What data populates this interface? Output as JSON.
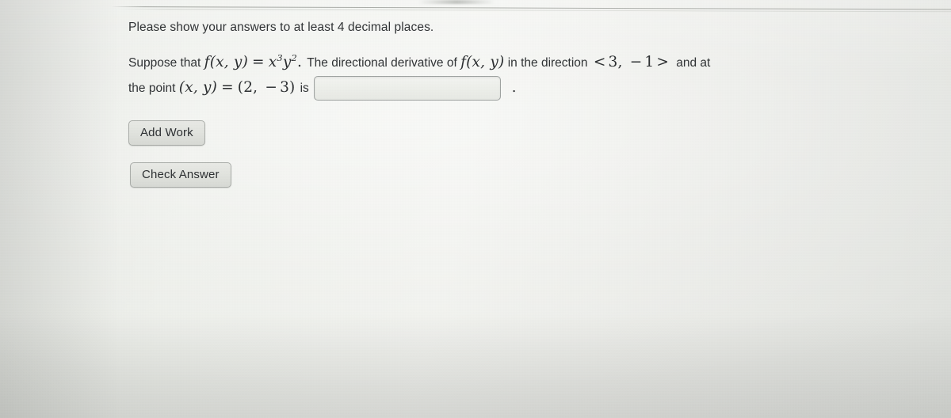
{
  "page": {
    "instruction": "Please show your answers to at least 4 decimal places."
  },
  "problem": {
    "line1": {
      "prefix": "Suppose that",
      "function_name_open": "f(x, y)",
      "equals": "=",
      "function_expression_base_x": "x",
      "function_expression_exp_x": "3",
      "function_expression_base_y": "y",
      "function_expression_exp_y": "2",
      "expression_period": ".",
      "middle_text": "The directional derivative of",
      "function_name_repeat": "f(x, y)",
      "direction_text": "in the direction",
      "direction_open": "<",
      "direction_first": "3",
      "direction_comma": ",",
      "direction_minus": "−",
      "direction_second": "1",
      "direction_close": ">",
      "suffix_text": "and at"
    },
    "line2": {
      "prefix": "the point",
      "point_label": "(x, y)",
      "equals": "=",
      "point_open": "(",
      "point_x": "2",
      "point_comma": ",",
      "point_minus": "−",
      "point_y": "3",
      "point_close": ")",
      "is_text": "is",
      "trailing_period": "."
    }
  },
  "answer_field": {
    "value": "",
    "placeholder": ""
  },
  "buttons": {
    "add_work": "Add Work",
    "check_answer": "Check Answer"
  },
  "colors": {
    "background": "#e9eae6",
    "text": "#2f3234",
    "math_text": "#2b2e30",
    "button_border": "#a9aca8",
    "input_border": "#9fa3a1"
  }
}
